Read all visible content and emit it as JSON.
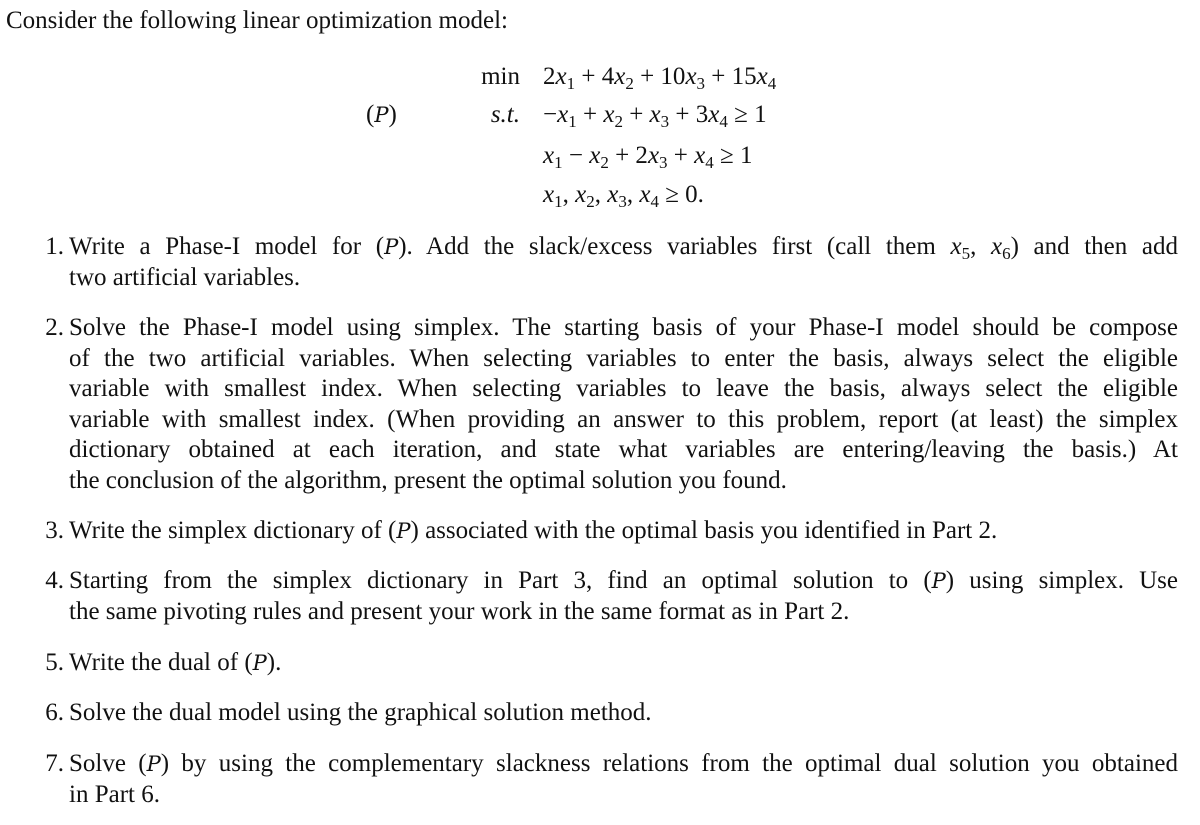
{
  "intro": "Consider the following linear optimization model:",
  "model": {
    "label": "P",
    "objective_keyword": "min",
    "objective": "2x1 + 4x2 + 10x3 + 15x4",
    "subject_to_keyword": "s.t.",
    "constraints": [
      "−x1 + x2 + x3 + 3x4 ≥ 1",
      "x1 − x2 + 2x3 + x4 ≥ 1",
      "x1, x2, x3, x4 ≥ 0."
    ]
  },
  "questions": [
    {
      "number": "1.",
      "lines": [
        "Write a Phase-I model for (P). Add the slack/excess variables first (call them x5, x6) and then add",
        "two artificial variables."
      ]
    },
    {
      "number": "2.",
      "lines": [
        "Solve the Phase-I model using simplex. The starting basis of your Phase-I model should be compose",
        "of the two artificial variables. When selecting variables to enter the basis, always select the eligible",
        "variable with smallest index. When selecting variables to leave the basis, always select the eligible",
        "variable with smallest index. (When providing an answer to this problem, report (at least) the simplex",
        "dictionary obtained at each iteration, and state what variables are entering/leaving the basis.) At",
        "the conclusion of the algorithm, present the optimal solution you found."
      ]
    },
    {
      "number": "3.",
      "lines": [
        "Write the simplex dictionary of (P) associated with the optimal basis you identified in Part 2."
      ]
    },
    {
      "number": "4.",
      "lines": [
        "Starting from the simplex dictionary in Part 3, find an optimal solution to (P) using simplex. Use",
        "the same pivoting rules and present your work in the same format as in Part 2."
      ]
    },
    {
      "number": "5.",
      "lines": [
        "Write the dual of (P)."
      ]
    },
    {
      "number": "6.",
      "lines": [
        "Solve the dual model using the graphical solution method."
      ]
    },
    {
      "number": "7.",
      "lines": [
        "Solve (P) by using the complementary slackness relations from the optimal dual solution you obtained",
        "in Part 6."
      ]
    }
  ]
}
